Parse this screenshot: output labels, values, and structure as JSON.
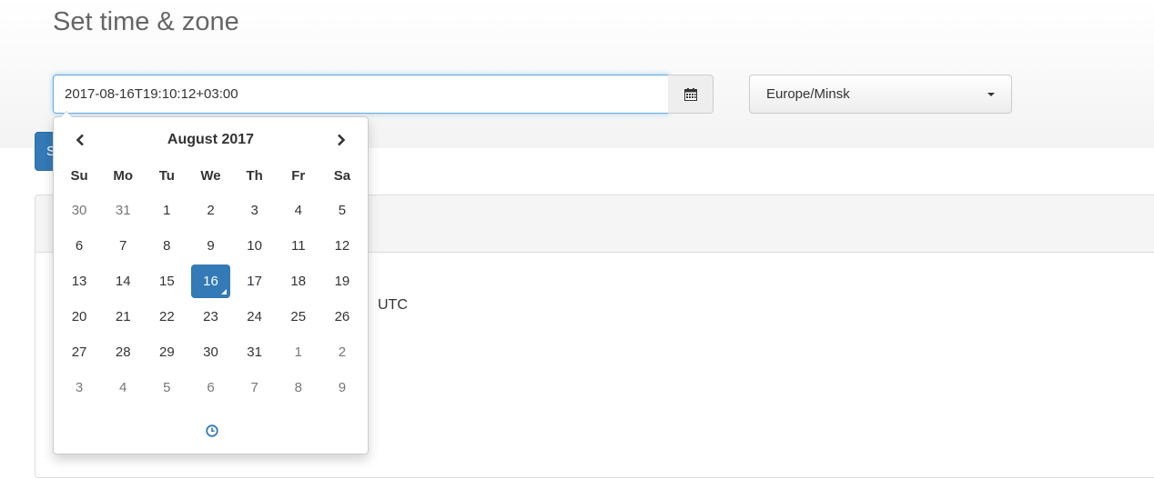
{
  "header": {
    "title": "Set time & zone"
  },
  "datetime_input": {
    "value": "2017-08-16T19:10:12+03:00"
  },
  "timezone_select": {
    "selected": "Europe/Minsk"
  },
  "set_button": {
    "label": "S"
  },
  "panel": {
    "utc_text": "UTC"
  },
  "datepicker": {
    "month_label": "August 2017",
    "weekdays": [
      "Su",
      "Mo",
      "Tu",
      "We",
      "Th",
      "Fr",
      "Sa"
    ],
    "weeks": [
      [
        {
          "d": "30",
          "t": "old"
        },
        {
          "d": "31",
          "t": "old"
        },
        {
          "d": "1",
          "t": ""
        },
        {
          "d": "2",
          "t": ""
        },
        {
          "d": "3",
          "t": ""
        },
        {
          "d": "4",
          "t": ""
        },
        {
          "d": "5",
          "t": ""
        }
      ],
      [
        {
          "d": "6",
          "t": ""
        },
        {
          "d": "7",
          "t": ""
        },
        {
          "d": "8",
          "t": ""
        },
        {
          "d": "9",
          "t": ""
        },
        {
          "d": "10",
          "t": ""
        },
        {
          "d": "11",
          "t": ""
        },
        {
          "d": "12",
          "t": ""
        }
      ],
      [
        {
          "d": "13",
          "t": ""
        },
        {
          "d": "14",
          "t": ""
        },
        {
          "d": "15",
          "t": ""
        },
        {
          "d": "16",
          "t": "active today"
        },
        {
          "d": "17",
          "t": ""
        },
        {
          "d": "18",
          "t": ""
        },
        {
          "d": "19",
          "t": ""
        }
      ],
      [
        {
          "d": "20",
          "t": ""
        },
        {
          "d": "21",
          "t": ""
        },
        {
          "d": "22",
          "t": ""
        },
        {
          "d": "23",
          "t": ""
        },
        {
          "d": "24",
          "t": ""
        },
        {
          "d": "25",
          "t": ""
        },
        {
          "d": "26",
          "t": ""
        }
      ],
      [
        {
          "d": "27",
          "t": ""
        },
        {
          "d": "28",
          "t": ""
        },
        {
          "d": "29",
          "t": ""
        },
        {
          "d": "30",
          "t": ""
        },
        {
          "d": "31",
          "t": ""
        },
        {
          "d": "1",
          "t": "new"
        },
        {
          "d": "2",
          "t": "new"
        }
      ],
      [
        {
          "d": "3",
          "t": "new"
        },
        {
          "d": "4",
          "t": "new"
        },
        {
          "d": "5",
          "t": "new"
        },
        {
          "d": "6",
          "t": "new"
        },
        {
          "d": "7",
          "t": "new"
        },
        {
          "d": "8",
          "t": "new"
        },
        {
          "d": "9",
          "t": "new"
        }
      ]
    ]
  },
  "icons": {
    "calendar": "calendar-icon",
    "prev": "chevron-left-icon",
    "next": "chevron-right-icon",
    "clock": "clock-icon",
    "dropdown": "caret-down-icon"
  },
  "colors": {
    "primary": "#337ab7",
    "muted_day": "#777777",
    "focus_border": "#66afe9"
  }
}
